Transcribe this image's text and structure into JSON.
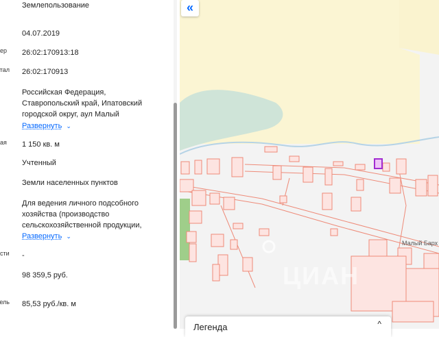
{
  "panel": {
    "fields": [
      {
        "label": "",
        "value": "Землепользование"
      },
      {
        "label": "",
        "value": "04.07.2019"
      },
      {
        "label": "ер",
        "value": "26:02:170913:18"
      },
      {
        "label": "тал",
        "value": "26:02:170913"
      },
      {
        "label": "",
        "value": "Российская Федерация, Ставропольский край, Ипатовский городской округ, аул Малый"
      },
      {
        "label": "ая",
        "value": "1 150 кв. м"
      },
      {
        "label": "",
        "value": "Учтенный"
      },
      {
        "label": "",
        "value": "Земли населенных пунктов"
      },
      {
        "label": "",
        "value": "Для ведения личного подсобного хозяйства (производство сельскохозяйственной продукции,"
      },
      {
        "label": "сти",
        "value": "-"
      },
      {
        "label": "",
        "value": "98 359,5 руб."
      },
      {
        "label": "ель",
        "value": "85,53 руб./кв. м"
      }
    ],
    "expand_label": "Развернуть"
  },
  "map": {
    "collapse_symbol": "«",
    "place_label": "Малый Барх",
    "watermark": "ЦИАН"
  },
  "legend": {
    "title": "Легенда",
    "toggle_symbol": "^"
  },
  "colors": {
    "accent": "#0468ff",
    "field": "#fbf5d3",
    "parcel_fill": "#fde4e1",
    "parcel_stroke": "#ee8a78",
    "water": "#b5d3e6",
    "forest": "#cfe4d8",
    "selected": "#a12bd1"
  }
}
